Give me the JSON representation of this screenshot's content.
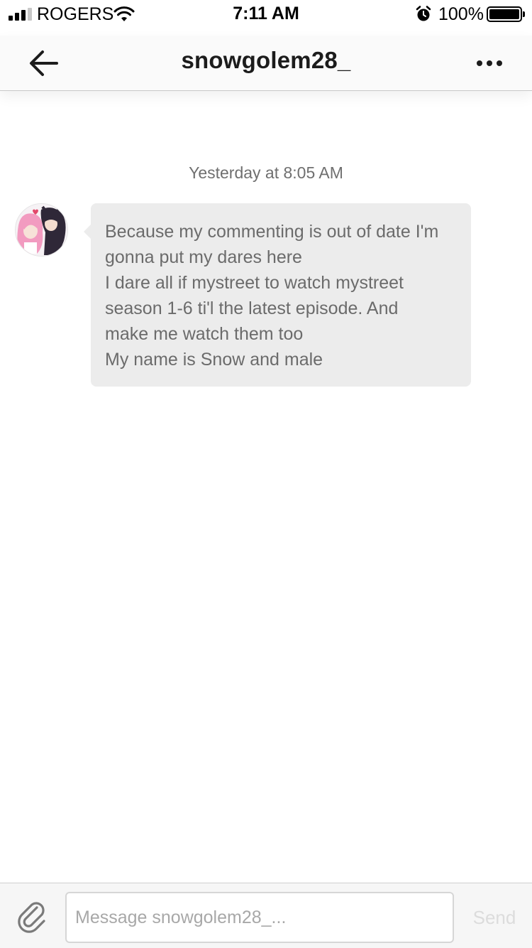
{
  "status_bar": {
    "carrier": "ROGERS",
    "time": "7:11 AM",
    "battery_percent": "100%",
    "signal_bars": 3,
    "signal_bars_total": 4,
    "icons": [
      "signal-icon",
      "wifi-icon",
      "alarm-icon",
      "battery-icon"
    ]
  },
  "nav": {
    "title": "snowgolem28_",
    "back_icon": "arrow-left-icon",
    "more_icon": "more-dots-icon"
  },
  "conversation": {
    "timestamp": "Yesterday at 8:05 AM",
    "messages": [
      {
        "sender": "snowgolem28_",
        "avatar_icon": "avatar-image",
        "lines": [
          "Because my commenting is out of date I'm",
          "gonna put my dares here",
          "I dare all if mystreet to watch mystreet",
          "season 1-6 ti'l the latest episode. And",
          "make me watch them too",
          "My name is Snow and male"
        ]
      }
    ]
  },
  "composer": {
    "placeholder": "Message snowgolem28_...",
    "value": "",
    "send_label": "Send",
    "attach_icon": "paperclip-icon"
  },
  "colors": {
    "bubble_bg": "#ececec",
    "bubble_text": "#6b6b6b",
    "timestamp_text": "#6f6f6f",
    "send_disabled": "#dcdcdc"
  }
}
